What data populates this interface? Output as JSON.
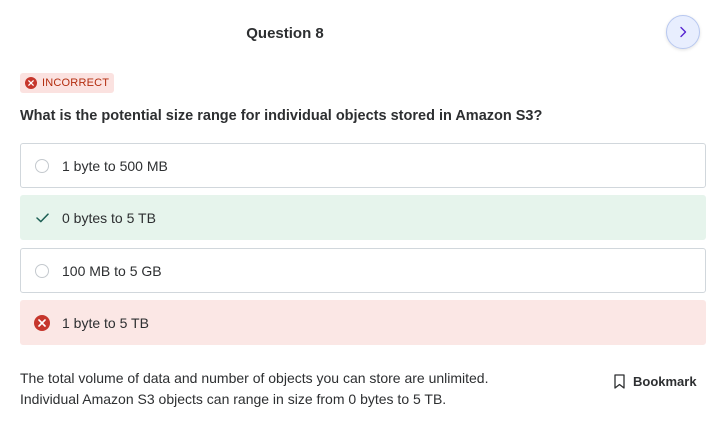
{
  "header": {
    "question_title": "Question 8"
  },
  "navigation": {
    "next_icon": "chevron-right-icon"
  },
  "result": {
    "status_label": "INCORRECT",
    "status_color": "#c6362c"
  },
  "question": {
    "text": "What is the potential size range for individual objects stored in Amazon S3?"
  },
  "options": [
    {
      "label": "1 byte to 500 MB",
      "state": "unselected"
    },
    {
      "label": "0 bytes to 5 TB",
      "state": "correct"
    },
    {
      "label": "100 MB to 5 GB",
      "state": "unselected"
    },
    {
      "label": "1 byte to 5 TB",
      "state": "selected-incorrect"
    }
  ],
  "explanation": {
    "line1": "The total volume of data and number of objects you can store are unlimited.",
    "line2": "Individual Amazon S3 objects can range in size from 0 bytes to 5 TB."
  },
  "bookmark": {
    "label": "Bookmark",
    "icon": "bookmark-icon"
  },
  "colors": {
    "correct_bg": "#e6f4ec",
    "correct_check": "#1e6055",
    "wrong_bg": "#fbe7e5",
    "wrong_icon": "#c6362c",
    "next_button_bg": "#e8eefe"
  }
}
